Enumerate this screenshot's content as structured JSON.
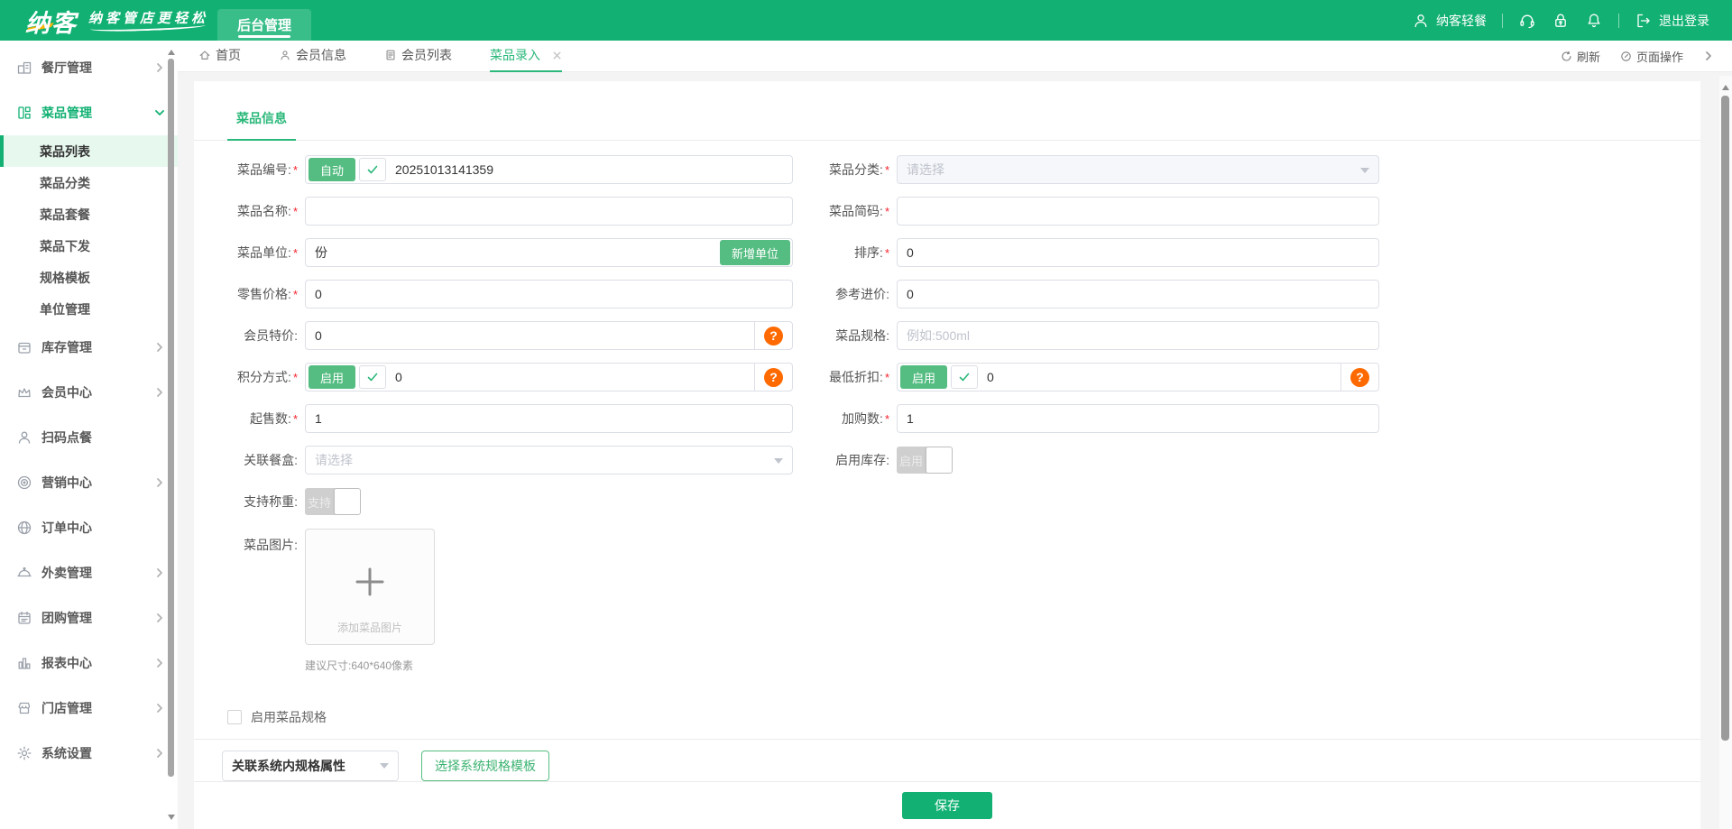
{
  "colors": {
    "primary_green": "#12b173",
    "active_tab_green": "#2bb87a",
    "button_green": "#55bd82",
    "light_green_bg": "#e7f8ee",
    "accent_orange": "#ff6a00",
    "logo_accent_yellow": "#ffb400",
    "required_red": "#f5222d"
  },
  "icons": [
    "user-icon",
    "headset-icon",
    "lock-icon",
    "bell-icon",
    "logout-icon",
    "home-icon",
    "member-icon",
    "list-icon",
    "close-icon",
    "refresh-icon",
    "page-operations-icon",
    "chevron-right-icon",
    "chevron-down-icon",
    "restaurant-icon",
    "dishes-icon",
    "inventory-icon",
    "member-center-icon",
    "scan-order-icon",
    "marketing-icon",
    "order-icon",
    "takeout-icon",
    "groupbuy-icon",
    "report-icon",
    "store-icon",
    "settings-icon",
    "check-icon",
    "plus-icon",
    "question-icon"
  ],
  "header": {
    "logo": "纳客",
    "slogan": "纳客管店更轻松",
    "nav_tab": "后台管理",
    "account": "纳客轻餐",
    "logout": "退出登录"
  },
  "tabbar": {
    "tabs": [
      {
        "label": "首页"
      },
      {
        "label": "会员信息"
      },
      {
        "label": "会员列表"
      },
      {
        "label": "菜品录入",
        "active": true
      }
    ],
    "refresh": "刷新",
    "page_ops": "页面操作"
  },
  "sidebar": {
    "items": [
      {
        "label": "餐厅管理",
        "icon": "restaurant-icon",
        "has_children": true
      },
      {
        "label": "菜品管理",
        "icon": "dishes-icon",
        "has_children": true,
        "expanded": true,
        "children": [
          {
            "label": "菜品列表",
            "active": true
          },
          {
            "label": "菜品分类"
          },
          {
            "label": "菜品套餐"
          },
          {
            "label": "菜品下发"
          },
          {
            "label": "规格模板"
          },
          {
            "label": "单位管理"
          }
        ]
      },
      {
        "label": "库存管理",
        "icon": "inventory-icon",
        "has_children": true
      },
      {
        "label": "会员中心",
        "icon": "member-center-icon",
        "has_children": true
      },
      {
        "label": "扫码点餐",
        "icon": "scan-order-icon",
        "has_children": false
      },
      {
        "label": "营销中心",
        "icon": "marketing-icon",
        "has_children": true
      },
      {
        "label": "订单中心",
        "icon": "order-icon",
        "has_children": false
      },
      {
        "label": "外卖管理",
        "icon": "takeout-icon",
        "has_children": true
      },
      {
        "label": "团购管理",
        "icon": "groupbuy-icon",
        "has_children": true
      },
      {
        "label": "报表中心",
        "icon": "report-icon",
        "has_children": true
      },
      {
        "label": "门店管理",
        "icon": "store-icon",
        "has_children": true
      },
      {
        "label": "系统设置",
        "icon": "settings-icon",
        "has_children": true
      }
    ]
  },
  "form": {
    "section_tab": "菜品信息",
    "required_mark": "*",
    "help_mark": "?",
    "fields": {
      "code": {
        "label": "菜品编号:",
        "required": true,
        "auto_button": "自动",
        "value": "20251013141359"
      },
      "category": {
        "label": "菜品分类:",
        "required": true,
        "placeholder": "请选择"
      },
      "name": {
        "label": "菜品名称:",
        "required": true,
        "value": ""
      },
      "short_code": {
        "label": "菜品简码:",
        "required": true,
        "value": ""
      },
      "unit": {
        "label": "菜品单位:",
        "required": true,
        "value": "份",
        "add_unit_button": "新增单位"
      },
      "sort": {
        "label": "排序:",
        "required": true,
        "value": "0"
      },
      "retail_price": {
        "label": "零售价格:",
        "required": true,
        "value": "0"
      },
      "reference_price": {
        "label": "参考进价:",
        "required": false,
        "value": "0"
      },
      "member_price": {
        "label": "会员特价:",
        "required": false,
        "value": "0"
      },
      "spec": {
        "label": "菜品规格:",
        "required": false,
        "placeholder": "例如:500ml"
      },
      "points_mode": {
        "label": "积分方式:",
        "required": true,
        "enable_button": "启用",
        "value": "0"
      },
      "min_discount": {
        "label": "最低折扣:",
        "required": true,
        "enable_button": "启用",
        "value": "0"
      },
      "min_sale_qty": {
        "label": "起售数:",
        "required": true,
        "value": "1"
      },
      "add_cart_qty": {
        "label": "加购数:",
        "required": true,
        "value": "1"
      },
      "meal_box": {
        "label": "关联餐盒:",
        "required": false,
        "placeholder": "请选择"
      },
      "enable_stock": {
        "label": "启用库存:",
        "switch_text": "启用",
        "on": false
      },
      "weighing": {
        "label": "支持称重:",
        "switch_text": "支持",
        "on": false
      },
      "image": {
        "label": "菜品图片:",
        "upload_text": "添加菜品图片",
        "size_hint": "建议尺寸:640*640像素"
      },
      "enable_dish_spec": {
        "label": "启用菜品规格",
        "checked": false
      },
      "spec_attr": {
        "value": "关联系统内规格属性"
      },
      "spec_template_button": "选择系统规格模板"
    },
    "save_button": "保存"
  }
}
